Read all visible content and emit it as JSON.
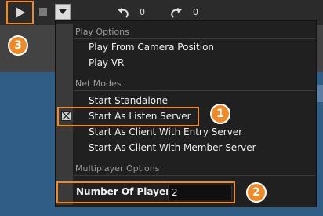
{
  "toolbar": {
    "play_icon": "play-icon",
    "stop_icon": "stop-icon",
    "dropdown_icon": "chevron-down-icon",
    "undo_count": "0",
    "redo_count": "0"
  },
  "menu": {
    "play_options_header": "Play Options",
    "play_from_camera": "Play From Camera Position",
    "play_vr": "Play VR",
    "net_modes_header": "Net Modes",
    "start_standalone": "Start Standalone",
    "start_listen_server": "Start As Listen Server",
    "start_client_entry": "Start As Client With Entry Server",
    "start_client_member": "Start As Client With Member Server",
    "multiplayer_header": "Multiplayer Options",
    "number_of_players_label": "Number Of Players",
    "number_of_players_value": "2"
  },
  "callouts": {
    "one": "1",
    "two": "2",
    "three": "3"
  },
  "colors": {
    "accent": "#f0892a",
    "menu_bg": "#202020",
    "toolbar_bg": "#2b2b2b"
  }
}
